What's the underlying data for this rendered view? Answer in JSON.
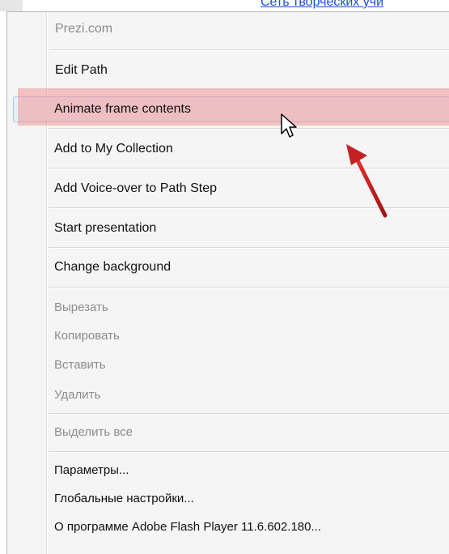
{
  "top_link": {
    "text": "Сеть творческих учи"
  },
  "menu": {
    "items": [
      {
        "label": "Prezi.com",
        "disabled": true
      },
      {
        "label": "Edit Path"
      },
      {
        "label": "Animate frame contents",
        "hovered": true
      },
      {
        "label": "Add to My Collection"
      },
      {
        "label": "Add Voice-over to Path Step"
      },
      {
        "label": "Start presentation"
      },
      {
        "label": "Change background"
      },
      {
        "label": "Вырезать",
        "disabled": true
      },
      {
        "label": "Копировать",
        "disabled": true
      },
      {
        "label": "Вставить",
        "disabled": true
      },
      {
        "label": "Удалить",
        "disabled": true
      },
      {
        "label": "Выделить все",
        "disabled": true
      },
      {
        "label": "Параметры..."
      },
      {
        "label": "Глобальные настройки..."
      },
      {
        "label": "О программе Adobe Flash Player 11.6.602.180..."
      }
    ]
  },
  "annotation": {
    "highlight_color": "#f09696",
    "arrow_color": "#c42222"
  },
  "icons": {
    "cursor": "mouse-pointer-icon",
    "arrow": "red-arrow-icon"
  }
}
